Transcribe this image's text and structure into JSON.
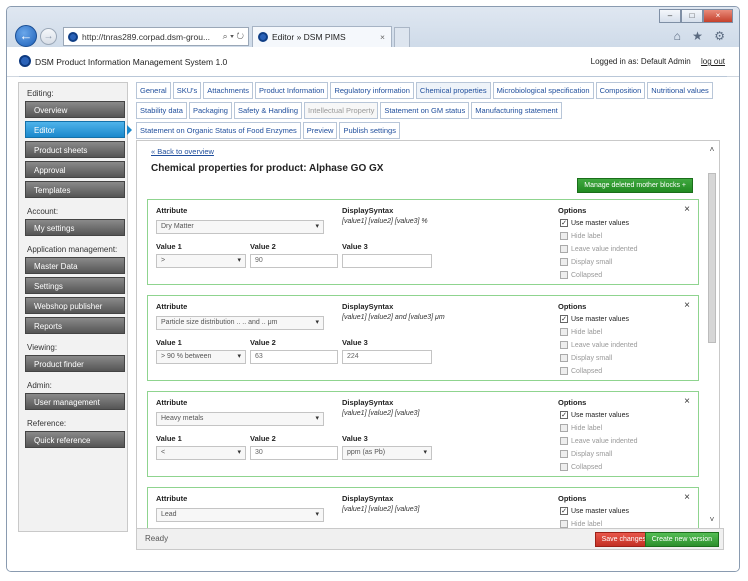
{
  "browser": {
    "url": "http://tnras289.corpad.dsm-grou...",
    "url_tools": "⌕ ▾ ↻",
    "tab_title": "Editor » DSM PIMS",
    "tab_close": "×",
    "back_glyph": "←",
    "fwd_glyph": "→",
    "right_icons": "⌂ ★ ⚙",
    "win_minimize": "–",
    "win_maximize": "□",
    "win_close": "×"
  },
  "app": {
    "title": "DSM Product Information Management System 1.0",
    "logged_in": "Logged in as: Default Admin",
    "logout": "log out"
  },
  "sidebar": {
    "editing_label": "Editing:",
    "editing_items": [
      {
        "label": "Overview"
      },
      {
        "label": "Editor"
      },
      {
        "label": "Product sheets"
      },
      {
        "label": "Approval"
      },
      {
        "label": "Templates"
      }
    ],
    "account_label": "Account:",
    "account_items": [
      {
        "label": "My settings"
      }
    ],
    "appmgmt_label": "Application management:",
    "appmgmt_items": [
      {
        "label": "Master Data"
      },
      {
        "label": "Settings"
      },
      {
        "label": "Webshop publisher"
      },
      {
        "label": "Reports"
      }
    ],
    "viewing_label": "Viewing:",
    "viewing_items": [
      {
        "label": "Product finder"
      }
    ],
    "admin_label": "Admin:",
    "admin_items": [
      {
        "label": "User management"
      }
    ],
    "reference_label": "Reference:",
    "reference_items": [
      {
        "label": "Quick reference"
      }
    ]
  },
  "tabs": {
    "row1": [
      "General",
      "SKU's",
      "Attachments",
      "Product Information",
      "Regulatory information",
      "Chemical properties",
      "Microbiological specification",
      "Composition",
      "Nutritional values"
    ],
    "row2": [
      "Stability data",
      "Packaging",
      "Safety & Handling",
      "Intellectual Property",
      "Statement on GM status",
      "Manufacturing statement"
    ],
    "row3": [
      "Statement on Organic Status of Food Enzymes",
      "Preview",
      "Publish settings"
    ]
  },
  "content": {
    "back_link": "« Back to overview",
    "page_title": "Chemical properties for product: Alphase GO GX",
    "manage_button": "Manage deleted mother blocks +",
    "labels": {
      "attribute": "Attribute",
      "display_syntax": "DisplaySyntax",
      "options": "Options",
      "value1": "Value 1",
      "value2": "Value 2",
      "value3": "Value 3"
    },
    "option_labels": [
      "Use master values",
      "Hide label",
      "Leave value indented",
      "Display small",
      "Collapsed"
    ],
    "close_glyph": "×",
    "caret": "▾",
    "check": "✓",
    "blocks": [
      {
        "attribute": "Dry Matter",
        "syntax": "[value1] [value2] [value3] %",
        "value1": ">",
        "value2": "90",
        "value3": ""
      },
      {
        "attribute": "Particle size distribution .. .. and .. μm",
        "syntax": "[value1] [value2] and [value3] μm",
        "value1": "> 90 % between",
        "value2": "63",
        "value3": "224"
      },
      {
        "attribute": "Heavy metals",
        "syntax": "[value1] [value2] [value3]",
        "value1": "<",
        "value2": "30",
        "value3": "ppm (as Pb)"
      },
      {
        "attribute": "Lead",
        "syntax": "[value1] [value2] [value3]",
        "value1": "",
        "value2": "",
        "value3": ""
      }
    ]
  },
  "footer": {
    "status": "Ready",
    "save": "Save changes",
    "create": "Create new version"
  },
  "scroll": {
    "up": "˄",
    "down": "˅"
  }
}
